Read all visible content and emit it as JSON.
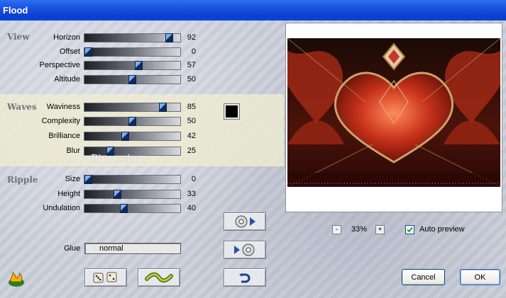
{
  "window": {
    "title": "Flood"
  },
  "sections": {
    "view": {
      "label": "View",
      "params": [
        {
          "label": "Horizon",
          "value": "92",
          "level": 0.92
        },
        {
          "label": "Offset",
          "value": "0",
          "level": 0.0
        },
        {
          "label": "Perspective",
          "value": "57",
          "level": 0.57
        },
        {
          "label": "Altitude",
          "value": "50",
          "level": 0.5
        }
      ]
    },
    "waves": {
      "label": "Waves",
      "params": [
        {
          "label": "Waviness",
          "value": "85",
          "level": 0.85
        },
        {
          "label": "Complexity",
          "value": "50",
          "level": 0.5
        },
        {
          "label": "Brilliance",
          "value": "42",
          "level": 0.42
        },
        {
          "label": "Blur",
          "value": "25",
          "level": 0.25
        }
      ],
      "color": "#000000"
    },
    "ripple": {
      "label": "Ripple",
      "params": [
        {
          "label": "Size",
          "value": "0",
          "level": 0.0
        },
        {
          "label": "Height",
          "value": "33",
          "level": 0.33
        },
        {
          "label": "Undulation",
          "value": "40",
          "level": 0.4
        }
      ]
    }
  },
  "glue": {
    "label": "Glue",
    "value": "normal"
  },
  "watermark": {
    "name": "Pinuccia",
    "url": "www.maidiregrafica.eu"
  },
  "zoom": {
    "minus": "-",
    "value": "33%",
    "plus": "+"
  },
  "auto_preview": {
    "label": "Auto preview",
    "checked": true
  },
  "buttons": {
    "cancel": "Cancel",
    "ok": "OK"
  },
  "icons": {
    "load": "disc-arrow-icon",
    "save": "arrow-disc-icon",
    "reset": "undo-arrow-icon",
    "random": "dice-icon",
    "wave": "wave-icon",
    "app": "flame-logo-icon"
  },
  "colors": {
    "titlebar": "#0a3fcf",
    "waves_band": "#eeecd2",
    "thumb": "#0d2a66"
  }
}
